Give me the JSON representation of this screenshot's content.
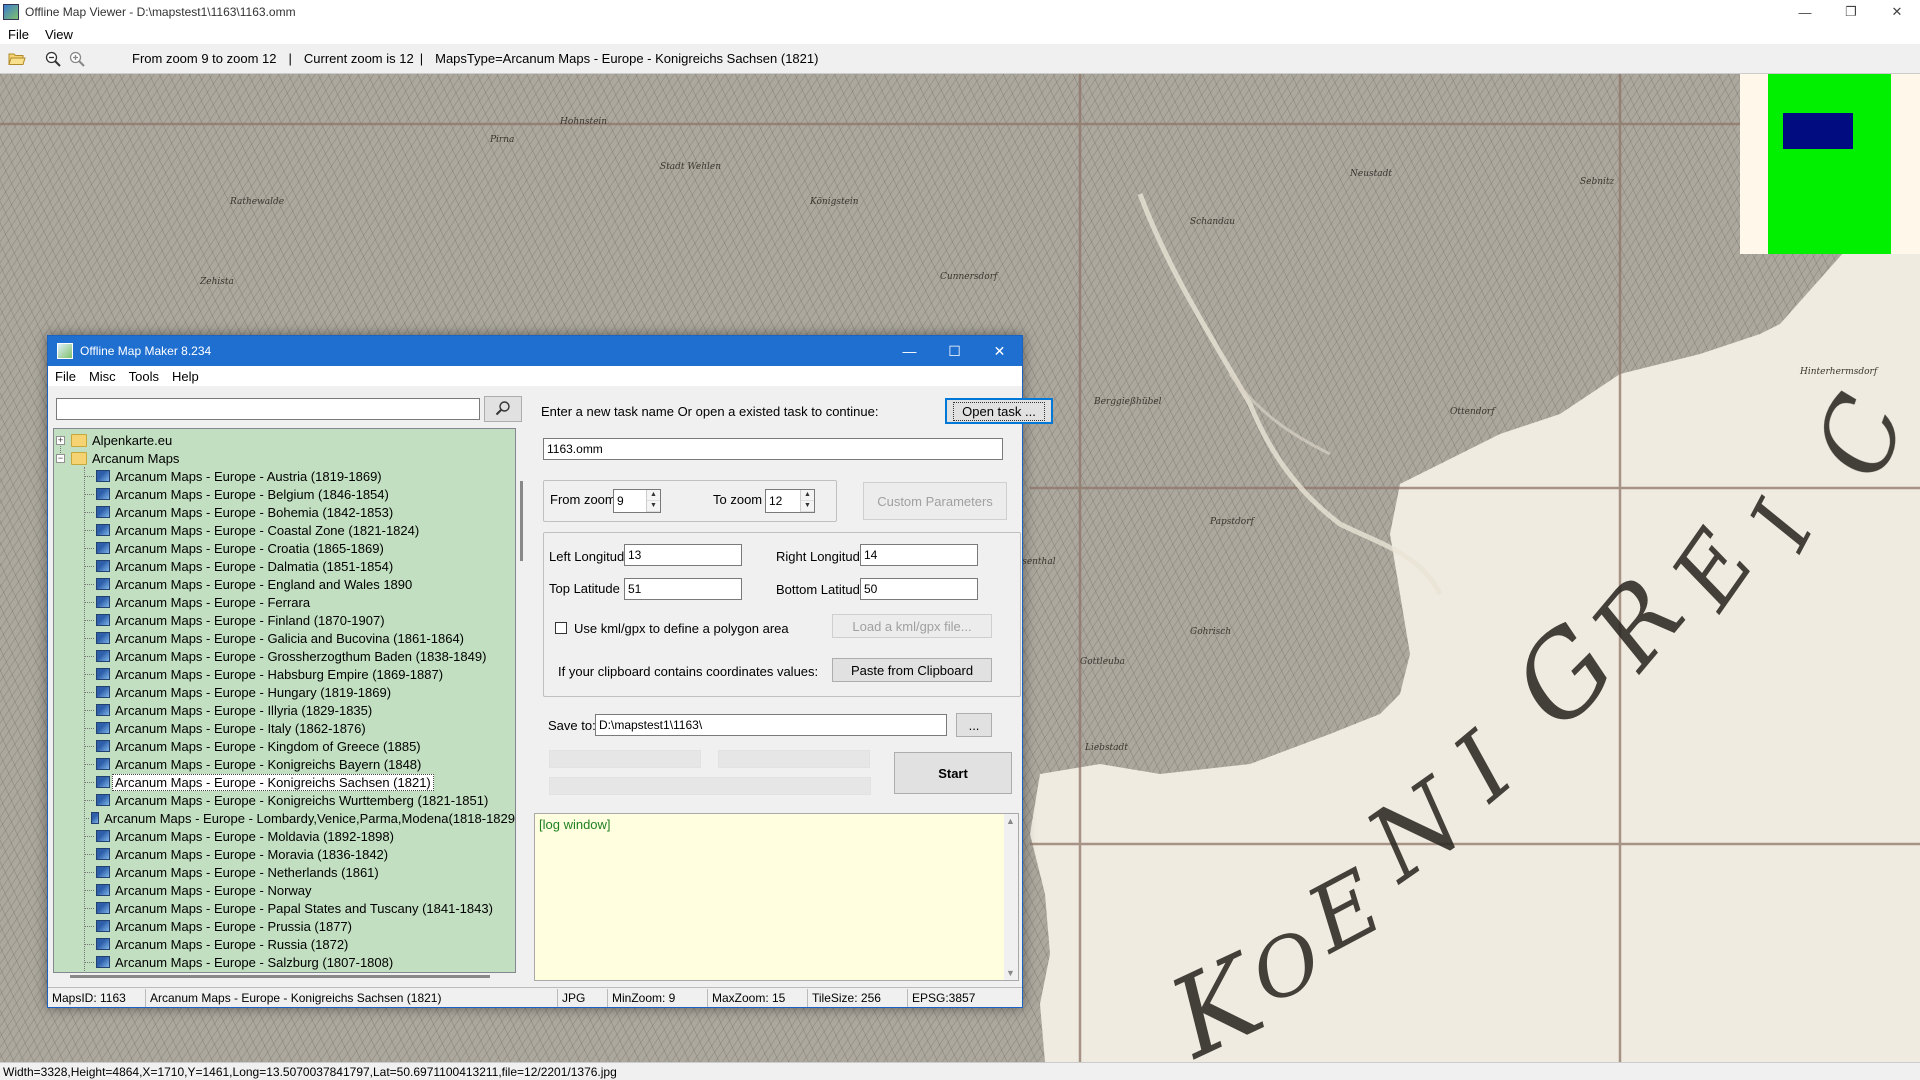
{
  "viewer": {
    "title": "Offline Map Viewer - D:\\mapstest1\\1163\\1163.omm",
    "menu": [
      "File",
      "View"
    ],
    "toolbar": {
      "zoom_range": "From zoom 9 to zoom 12",
      "current_zoom": "Current zoom is 12",
      "maps_type": "MapsType=Arcanum Maps - Europe - Konigreichs Sachsen (1821)",
      "separator": "|"
    },
    "status": "Width=3328,Height=4864,X=1710,Y=1461,Long=13.5070037841797,Lat=50.6971100413211,file=12/2201/1376.jpg"
  },
  "map_labels": [
    "Hohnstein",
    "Rathewalde",
    "Stadt Wehlen",
    "Pirna",
    "Schandau",
    "Königstein",
    "Gottleuba",
    "Berggießhübel",
    "Liebstadt",
    "Neustadt",
    "Sebnitz",
    "Zehista",
    "Cunnersdorf",
    "Rosenthal",
    "Hinterhermsdorf",
    "Ottendorf",
    "Gohrisch",
    "Papstdorf"
  ],
  "map_script_letters": [
    "K",
    "O",
    "E",
    "N",
    "I",
    "G",
    "R",
    "E",
    "I",
    "C"
  ],
  "dialog": {
    "title": "Offline Map Maker 8.234",
    "menu": [
      "File",
      "Misc",
      "Tools",
      "Help"
    ],
    "search": {
      "value": ""
    },
    "tree": {
      "folders": [
        {
          "label": "Alpenkarte.eu",
          "expanded": false
        },
        {
          "label": "Arcanum Maps",
          "expanded": true
        }
      ],
      "items": [
        "Arcanum Maps - Europe - Austria (1819-1869)",
        "Arcanum Maps - Europe - Belgium (1846-1854)",
        "Arcanum Maps - Europe - Bohemia (1842-1853)",
        "Arcanum Maps - Europe - Coastal Zone (1821-1824)",
        "Arcanum Maps - Europe - Croatia (1865-1869)",
        "Arcanum Maps - Europe - Dalmatia (1851-1854)",
        "Arcanum Maps - Europe - England and Wales 1890",
        "Arcanum Maps - Europe - Ferrara",
        "Arcanum Maps - Europe - Finland (1870-1907)",
        "Arcanum Maps - Europe - Galicia and Bucovina (1861-1864)",
        "Arcanum Maps - Europe - Grossherzogthum Baden (1838-1849)",
        "Arcanum Maps - Europe - Habsburg Empire (1869-1887)",
        "Arcanum Maps - Europe - Hungary (1819-1869)",
        "Arcanum Maps - Europe - Illyria (1829-1835)",
        "Arcanum Maps - Europe - Italy (1862-1876)",
        "Arcanum Maps - Europe - Kingdom of Greece (1885)",
        "Arcanum Maps - Europe - Konigreichs Bayern (1848)",
        "Arcanum Maps - Europe - Konigreichs Sachsen (1821)",
        "Arcanum Maps - Europe - Konigreichs Wurttemberg (1821-1851)",
        "Arcanum Maps - Europe - Lombardy,Venice,Parma,Modena(1818-1829",
        "Arcanum Maps - Europe - Moldavia (1892-1898)",
        "Arcanum Maps - Europe - Moravia (1836-1842)",
        "Arcanum Maps - Europe - Netherlands (1861)",
        "Arcanum Maps - Europe - Norway",
        "Arcanum Maps - Europe - Papal States and Tuscany (1841-1843)",
        "Arcanum Maps - Europe - Prussia (1877)",
        "Arcanum Maps - Europe - Russia (1872)",
        "Arcanum Maps - Europe - Salzburg (1807-1808)"
      ],
      "selected_index": 17
    },
    "task_prompt": "Enter a new task name Or open a existed task to continue:",
    "open_task_button": "Open task ...",
    "task_name": "1163.omm",
    "from_zoom_label": "From zoom",
    "from_zoom_value": "9",
    "to_zoom_label": "To zoom",
    "to_zoom_value": "12",
    "custom_params_button": "Custom Parameters",
    "left_longitude_label": "Left Longitude",
    "left_longitude_value": "13",
    "right_longitude_label": "Right Longitude",
    "right_longitude_value": "14",
    "top_latitude_label": "Top Latitude",
    "top_latitude_value": "51",
    "bottom_latitude_label": "Bottom Latitude",
    "bottom_latitude_value": "50",
    "kml_checkbox_label": "Use kml/gpx to define a polygon area",
    "kml_checked": false,
    "load_kml_button": "Load a kml/gpx file...",
    "clipboard_prompt": "If your clipboard contains coordinates values:",
    "paste_button": "Paste from Clipboard",
    "save_to_label": "Save to:",
    "save_to_value": "D:\\mapstest1\\1163\\",
    "browse_button": "...",
    "start_button": "Start",
    "log_text": "[log window]",
    "status": {
      "maps_id": "MapsID: 1163",
      "map_name": "Arcanum Maps - Europe - Konigreichs Sachsen (1821)",
      "format": "JPG",
      "min_zoom": "MinZoom: 9",
      "max_zoom": "MaxZoom: 15",
      "tile_size": "TileSize: 256",
      "epsg": "EPSG:3857"
    }
  },
  "colors": {
    "tree_background": "#c2dfc1",
    "log_background": "#ffffe0",
    "log_text": "#208020",
    "dialog_titlebar": "#1f6fd1",
    "minimap_green": "#00f000",
    "minimap_blue": "#000c80"
  }
}
